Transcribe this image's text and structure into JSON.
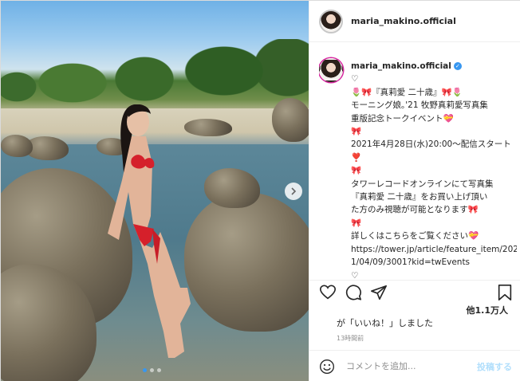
{
  "post": {
    "username": "maria_makino.official",
    "verified_glyph": "✓",
    "caption_lines": [
      "♡",
      "🌷🎀『真莉愛 二十歳』🎀🌷",
      "モーニング娘｡'21 牧野真莉愛写真集",
      "重版記念トークイベント💝",
      "🎀",
      "2021年4月28日(水)20:00〜配信スタート",
      "❣️",
      "🎀",
      "タワーレコードオンラインにて写真集",
      "『真莉愛 二十歳』をお買い上げ頂い",
      "た方のみ視聴が可能となります🎀",
      "🎀",
      "詳しくはこちらをご覧ください💝",
      "https://tower.jp/article/feature_item/2021/04/09/3001?kid=twEvents",
      "♡",
      "♡"
    ],
    "likes": "他1.1万人",
    "liked_by_suffix": "が「いいね！」しました",
    "time": "13時間前"
  },
  "comment": {
    "placeholder": "コメントを追加...",
    "post_label": "投稿する"
  },
  "carousel": {
    "current": 1,
    "total": 3
  },
  "icons": [
    "heart-icon",
    "comment-icon",
    "share-icon",
    "bookmark-icon",
    "emoji-icon",
    "next-arrow-icon",
    "verified-icon"
  ],
  "colors": {
    "accent": "#3897f0",
    "verified": "#3897f0",
    "post_button_disabled": "#b2dffc",
    "story_ring": "#d6249f"
  }
}
